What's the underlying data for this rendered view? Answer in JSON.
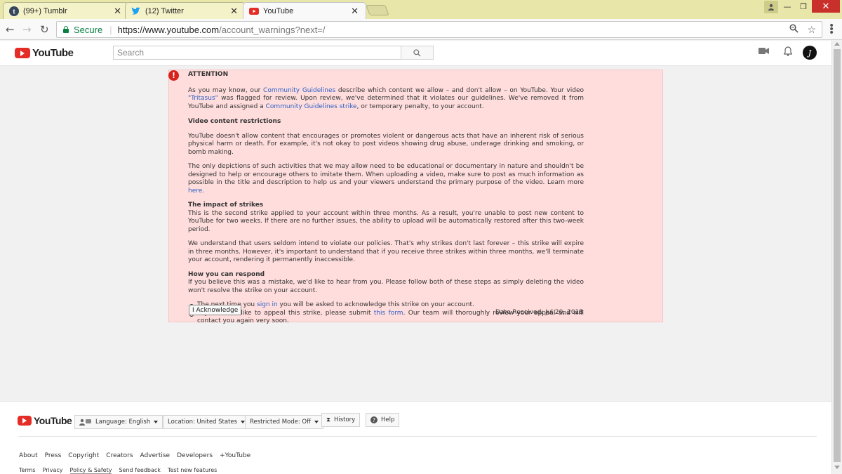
{
  "browser": {
    "tabs": [
      {
        "icon": "tumblr-icon",
        "label": "(99+) Tumblr"
      },
      {
        "icon": "twitter-icon",
        "label": "(12) Twitter"
      },
      {
        "icon": "youtube-icon",
        "label": "YouTube"
      }
    ],
    "secure_label": "Secure",
    "url_host": "https://www.youtube.com",
    "url_path": "/account_warnings?next=/"
  },
  "header": {
    "logo_text": "YouTube",
    "search_placeholder": "Search",
    "avatar_letter": "J"
  },
  "warning": {
    "attention": "ATTENTION",
    "p1_a": "As you may know, our ",
    "p1_link1": "Community Guidelines",
    "p1_b": " describe which content we allow – and don't allow – on YouTube. Your video ",
    "p1_link2": "\"Tritasus\"",
    "p1_c": " was flagged for review. Upon review, we've determined that it violates our guidelines. We've removed it from YouTube and assigned a ",
    "p1_link3": "Community Guidelines strike",
    "p1_d": ", or temporary penalty, to your account.",
    "h_video": "Video content restrictions",
    "p2": "YouTube doesn't allow content that encourages or promotes violent or dangerous acts that have an inherent risk of serious physical harm or death. For example, it's not okay to post videos showing drug abuse, underage drinking and smoking, or bomb making.",
    "p3_a": "The only depictions of such activities that we may allow need to be educational or documentary in nature and shouldn't be designed to help or encourage others to imitate them. When uploading a video, make sure to post as much information as possible in the title and description to help us and your viewers understand the primary purpose of the video. Learn more ",
    "p3_link": "here",
    "p3_b": ".",
    "h_impact": "The impact of strikes",
    "p4": "This is the second strike applied to your account within three months. As a result, you're unable to post new content to YouTube for two weeks. If there are no further issues, the ability to upload will be automatically restored after this two-week period.",
    "p5": "We understand that users seldom intend to violate our policies. That's why strikes don't last forever – this strike will expire in three months. However, it's important to understand that if you receive three strikes within three months, we'll terminate your account, rendering it permanently inaccessible.",
    "h_respond": "How you can respond",
    "p6": "If you believe this was a mistake, we'd like to hear from you. Please follow both of these steps as simply deleting the video won't resolve the strike on your account.",
    "b1_a": "The next time you ",
    "b1_link": "sign in",
    "b1_b": " you will be asked to acknowledge this strike on your account.",
    "b2_a": "If you would like to appeal this strike, please submit ",
    "b2_link": "this form",
    "b2_b": ". Our team will thoroughly review your appeal and will contact you again very soon.",
    "ack_button": "I Acknowledge",
    "date_received": "Date Received: Jul 20, 2018"
  },
  "footer": {
    "logo_text": "YouTube",
    "language": "Language: English",
    "location": "Location: United States",
    "restricted": "Restricted Mode: Off",
    "history": "History",
    "help": "Help",
    "links": [
      "About",
      "Press",
      "Copyright",
      "Creators",
      "Advertise",
      "Developers",
      "+YouTube"
    ],
    "links2": [
      "Terms",
      "Privacy",
      "Policy & Safety",
      "Send feedback",
      "Test new features"
    ]
  }
}
